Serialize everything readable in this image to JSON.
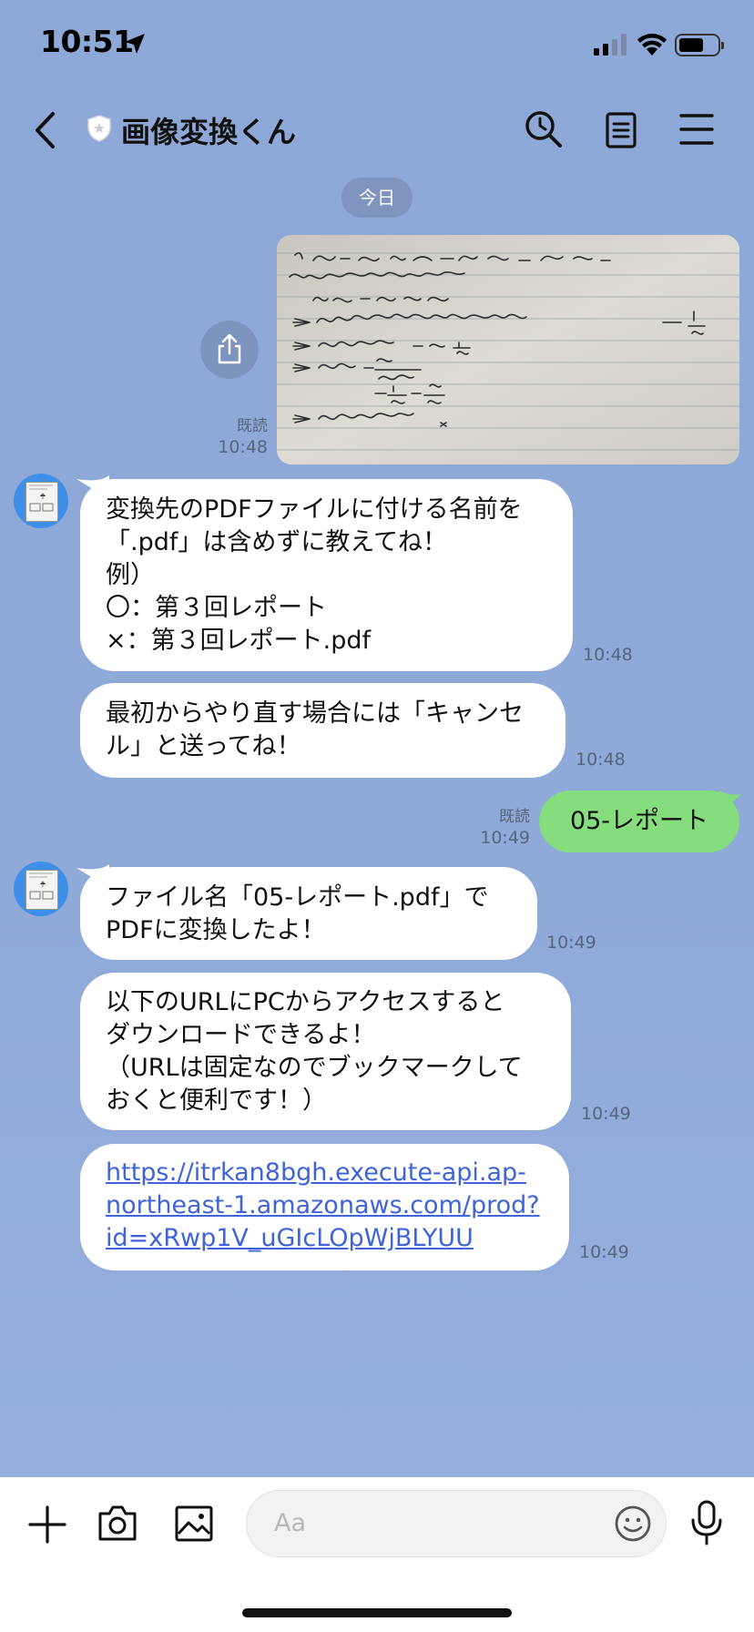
{
  "status_bar": {
    "time": "10:51",
    "battery_level": 0.6
  },
  "header": {
    "title": "画像変換くん"
  },
  "date_separator": "今日",
  "messages": {
    "image_read": "既読",
    "image_time": "10:48",
    "bot1": {
      "lines": [
        "変換先のPDFファイルに付ける名前を",
        "「.pdf」は含めずに教えてね！",
        "例）",
        "〇：第３回レポート",
        "×：第３回レポート.pdf"
      ],
      "time": "10:48"
    },
    "bot2": {
      "lines": [
        "最初からやり直す場合には「キャンセ",
        "ル」と送ってね！"
      ],
      "time": "10:48"
    },
    "user": {
      "text": "05-レポート",
      "read": "既読",
      "time": "10:49"
    },
    "bot3": {
      "lines": [
        "ファイル名「05-レポート.pdf」で",
        "PDFに変換したよ！"
      ],
      "time": "10:49"
    },
    "bot4": {
      "lines": [
        "以下のURLにPCからアクセスすると",
        "ダウンロードできるよ！",
        "（URLは固定なのでブックマークして",
        "おくと便利です！）"
      ],
      "time": "10:49"
    },
    "bot5": {
      "lines": [
        "https://itrkan8bgh.execute-api.ap-",
        "northeast-1.amazonaws.com/prod?",
        "id=xRwp1V_uGIcLOpWjBLYUU"
      ],
      "time": "10:49"
    }
  },
  "composer": {
    "placeholder": "Aa"
  },
  "icons": [
    "location-arrow-icon",
    "signal-icon",
    "wifi-icon",
    "battery-icon",
    "back-icon",
    "shield-icon",
    "search-icon",
    "notes-icon",
    "menu-icon",
    "share-icon",
    "plus-icon",
    "camera-icon",
    "image-icon",
    "emoji-icon",
    "mic-icon"
  ]
}
